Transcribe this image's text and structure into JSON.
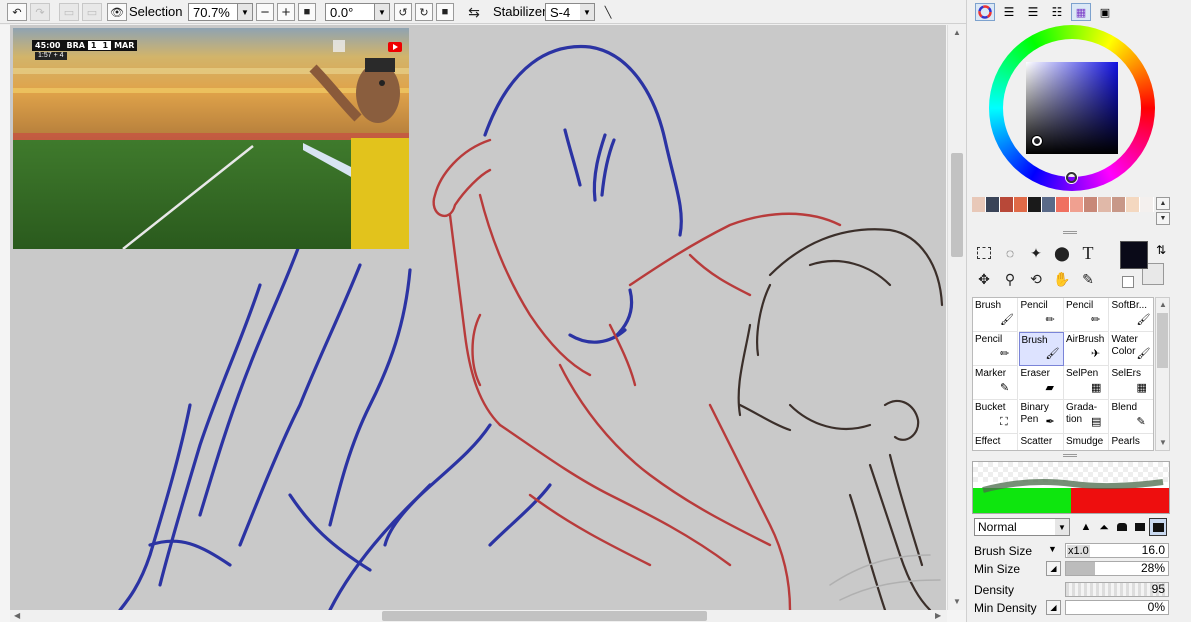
{
  "toolbar": {
    "selection_label": "Selection",
    "zoom_value": "70.7%",
    "rotation_value": "0.0°",
    "stabilizer_label": "Stabilizer",
    "stabilizer_value": "S-4"
  },
  "video": {
    "clock": "45:00",
    "team_home": "BRA",
    "score_home": "1",
    "score_away": "1",
    "team_away": "MAR",
    "subline": "1:57 + 4"
  },
  "colors": {
    "swatches": [
      "#e8c8b8",
      "#3a4458",
      "#b84838",
      "#e06a48",
      "#1a1a1a",
      "#5a6a88",
      "#f07060",
      "#f0a090",
      "#c88878",
      "#e0b8a8",
      "#c89888",
      "#f4d8c0",
      "#f4f0ee"
    ],
    "primary": "#0a0a18",
    "secondary": "#e8e8e8"
  },
  "brushes": [
    {
      "label": "Brush",
      "icon": "brush-icon"
    },
    {
      "label": "Pencil",
      "icon": "pencil-icon"
    },
    {
      "label": "Pencil",
      "icon": "pencil-icon"
    },
    {
      "label": "SoftBr...",
      "icon": "softbrush-icon"
    },
    {
      "label": "Pencil",
      "icon": "pencil-icon"
    },
    {
      "label": "Brush",
      "icon": "brush-icon",
      "selected": true
    },
    {
      "label": "AirBrush",
      "icon": "airbrush-icon"
    },
    {
      "label": "Water Color",
      "icon": "watercolor-icon"
    },
    {
      "label": "Marker",
      "icon": "marker-icon"
    },
    {
      "label": "Eraser",
      "icon": "eraser-icon"
    },
    {
      "label": "SelPen",
      "icon": "selpen-icon"
    },
    {
      "label": "SelErs",
      "icon": "selers-icon"
    },
    {
      "label": "Bucket",
      "icon": "bucket-icon"
    },
    {
      "label": "Binary Pen",
      "icon": "binary-pen-icon"
    },
    {
      "label": "Grada- tion",
      "icon": "gradation-icon"
    },
    {
      "label": "Blend",
      "icon": "blend-icon"
    },
    {
      "label": "Effect",
      "icon": "effect-icon"
    },
    {
      "label": "Scatter",
      "icon": "scatter-icon"
    },
    {
      "label": "Smudge",
      "icon": "smudge-icon"
    },
    {
      "label": "Pearls",
      "icon": "pearls-icon"
    }
  ],
  "brush_settings": {
    "blend_mode": "Normal",
    "brush_size_label": "Brush Size",
    "brush_size_multiplier": "x1.0",
    "brush_size_value": "16.0",
    "min_size_label": "Min Size",
    "min_size_value": "28%",
    "min_size_fraction": 0.28,
    "density_label": "Density",
    "density_value": "95",
    "min_density_label": "Min Density",
    "min_density_value": "0%",
    "min_density_fraction": 0.0
  }
}
